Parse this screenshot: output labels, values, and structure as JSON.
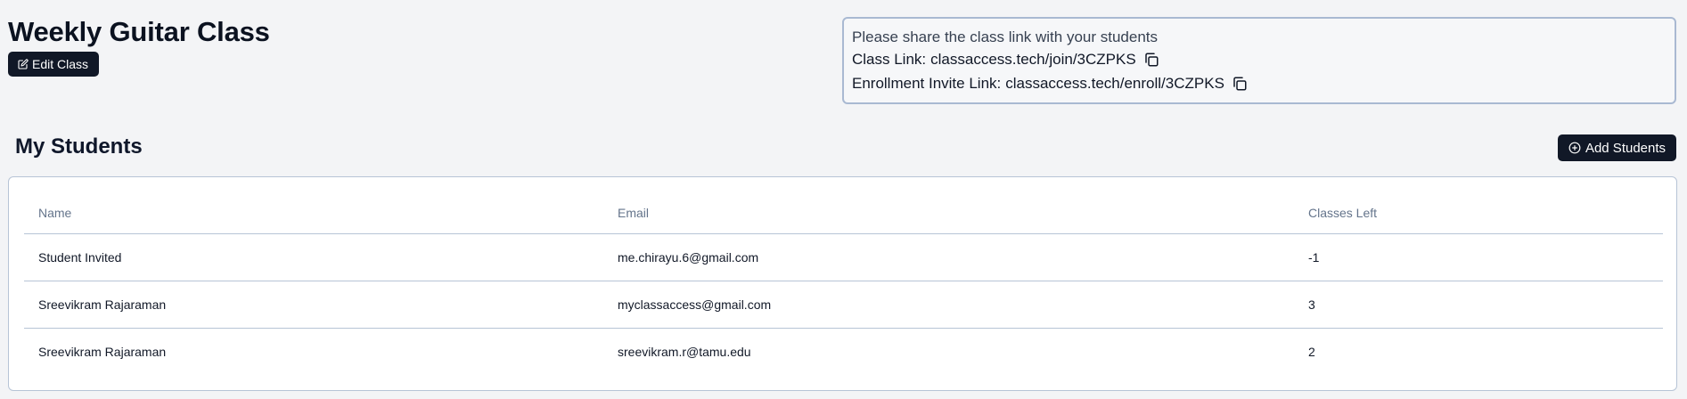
{
  "header": {
    "class_title": "Weekly Guitar Class",
    "edit_label": "Edit Class"
  },
  "share": {
    "note": "Please share the class link with your students",
    "class_link_label": "Class Link:",
    "class_link_value": "classaccess.tech/join/3CZPKS",
    "enroll_link_label": "Enrollment Invite Link:",
    "enroll_link_value": "classaccess.tech/enroll/3CZPKS"
  },
  "students": {
    "title": "My Students",
    "add_label": "Add Students",
    "columns": [
      "Name",
      "Email",
      "Classes Left"
    ],
    "rows": [
      {
        "name": "Student Invited",
        "email": "me.chirayu.6@gmail.com",
        "classes_left": "-1"
      },
      {
        "name": "Sreevikram Rajaraman",
        "email": "myclassaccess@gmail.com",
        "classes_left": "3"
      },
      {
        "name": "Sreevikram Rajaraman",
        "email": "sreevikram.r@tamu.edu",
        "classes_left": "2"
      }
    ]
  },
  "icons": {
    "edit": "edit-icon",
    "copy": "copy-icon",
    "add": "plus-circle-icon"
  },
  "colors": {
    "primary_button": "#111827",
    "border": "#b7c4d6",
    "background": "#f3f4f6"
  }
}
